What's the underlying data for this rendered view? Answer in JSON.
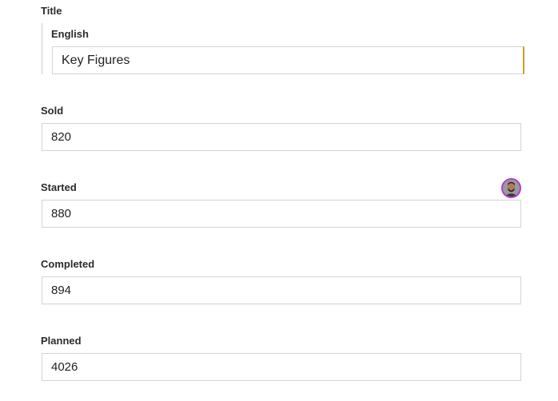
{
  "title_group": {
    "label": "Title",
    "english_label": "English",
    "english_value": "Key Figures"
  },
  "fields": {
    "sold": {
      "label": "Sold",
      "value": "820"
    },
    "started": {
      "label": "Started",
      "value": "880"
    },
    "completed": {
      "label": "Completed",
      "value": "894"
    },
    "planned": {
      "label": "Planned",
      "value": "4026"
    }
  },
  "presence": {
    "avatar_icon": "user-avatar-icon",
    "avatar_ring_color": "#b23ad6",
    "title_edit_indicator_color": "#c9a227"
  }
}
